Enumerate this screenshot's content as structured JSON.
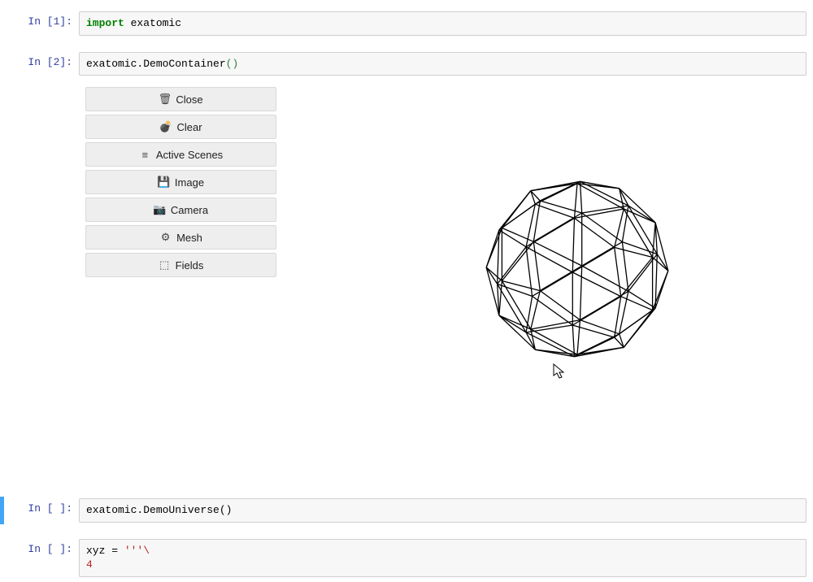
{
  "cells": {
    "c1": {
      "prompt": "In [1]:"
    },
    "c2": {
      "prompt": "In [2]:"
    },
    "c3": {
      "prompt": "In [ ]:",
      "code": "exatomic.DemoUniverse()"
    },
    "c4": {
      "prompt": "In [ ]:"
    }
  },
  "code1": {
    "import_kw": "import",
    "rest": " exatomic"
  },
  "code2": {
    "pre": "exatomic.DemoContainer",
    "paren": "()"
  },
  "code4": {
    "line1_pre": "xyz = ",
    "line1_str": "'''\\",
    "line2": "4"
  },
  "widget_buttons": [
    {
      "icon": "trash-icon",
      "glyph": "🗑",
      "label": "Close"
    },
    {
      "icon": "bomb-icon",
      "glyph": "💣",
      "label": "Clear"
    },
    {
      "icon": "menu-icon",
      "glyph": "≡",
      "label": "Active Scenes"
    },
    {
      "icon": "save-icon",
      "glyph": "💾",
      "label": "Image"
    },
    {
      "icon": "camera-icon",
      "glyph": "📷",
      "label": "Camera"
    },
    {
      "icon": "gear-icon",
      "glyph": "⚙",
      "label": "Mesh"
    },
    {
      "icon": "cube-icon",
      "glyph": "⬚",
      "label": "Fields"
    }
  ]
}
